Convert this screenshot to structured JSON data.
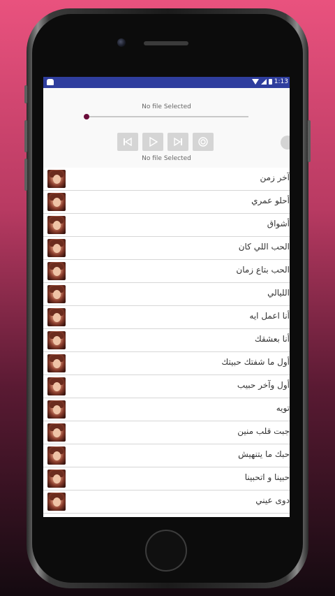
{
  "status_bar": {
    "time": "1:13"
  },
  "player": {
    "top_file_text": "No file Selected",
    "bottom_file_text": "No file Selected",
    "progress": 0.0
  },
  "songs": [
    {
      "title": "آخر زمن"
    },
    {
      "title": "أحلو عمري"
    },
    {
      "title": "أشواق"
    },
    {
      "title": "الحب اللي كان"
    },
    {
      "title": "الحب بتاع زمان"
    },
    {
      "title": "الليالي"
    },
    {
      "title": "أنا اعمل ايه"
    },
    {
      "title": "أنا بعشقك"
    },
    {
      "title": "أول ما شفتك حبيتك"
    },
    {
      "title": "أول وآخر حبيب"
    },
    {
      "title": "تويه"
    },
    {
      "title": "جبت قلب منين"
    },
    {
      "title": "حبك ما يتنهيش"
    },
    {
      "title": "حبينا و اتحبينا"
    },
    {
      "title": "دوى عيني"
    }
  ]
}
